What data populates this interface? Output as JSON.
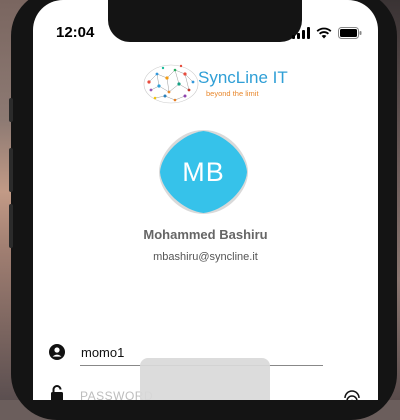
{
  "status_bar": {
    "time": "12:04"
  },
  "logo": {
    "name": "SyncLine IT",
    "tagline": "beyond the limit"
  },
  "profile": {
    "initials": "MB",
    "name": "Mohammed Bashiru",
    "email": "mbashiru@syncline.it"
  },
  "form": {
    "username_value": "momo1",
    "password_placeholder": "PASSWORD"
  },
  "icons": {
    "user": "user-icon",
    "lock": "lock-icon",
    "fingerprint": "fingerprint-icon",
    "wifi": "wifi-icon",
    "battery": "battery-icon",
    "signal": "signal-icon"
  },
  "colors": {
    "avatar": "#36c2ea",
    "logo_blue": "#2f9fd6",
    "logo_orange": "#e8882d"
  }
}
